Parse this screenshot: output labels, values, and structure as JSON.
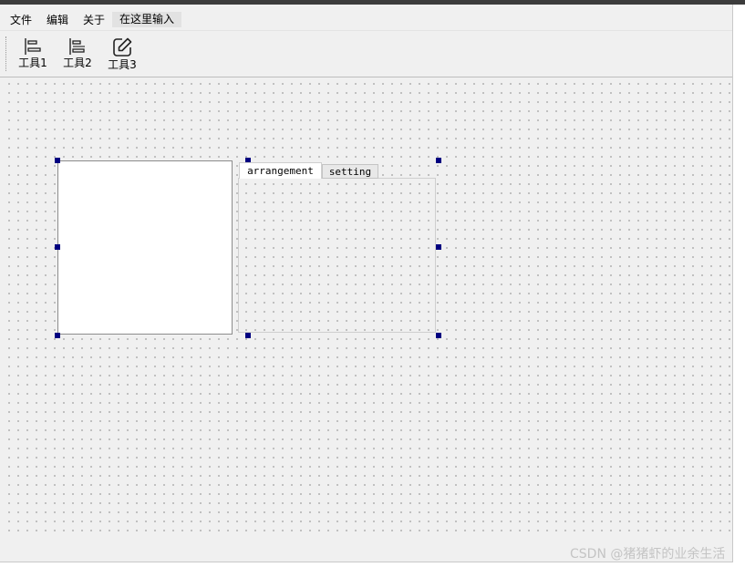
{
  "menubar": {
    "items": [
      "文件",
      "编辑",
      "关于"
    ],
    "input_placeholder": "在这里输入"
  },
  "toolbar": {
    "tools": [
      {
        "label": "工具1",
        "icon": "align-left-icon"
      },
      {
        "label": "工具2",
        "icon": "align-center-icon"
      },
      {
        "label": "工具3",
        "icon": "edit-icon"
      }
    ]
  },
  "tabwidget": {
    "tabs": [
      "arrangement",
      "setting"
    ],
    "active_tab": "arrangement"
  },
  "selection_handle_color": "#000080",
  "watermark": "CSDN @猪猪虾的业余生活"
}
